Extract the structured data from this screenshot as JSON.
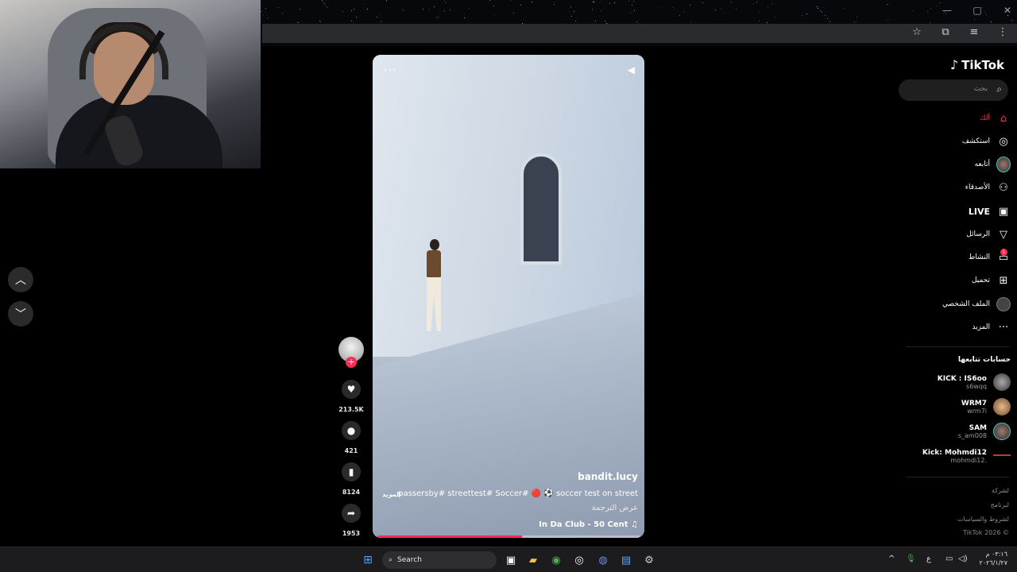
{
  "browser": {
    "window_controls": [
      "—",
      "▢",
      "✕"
    ],
    "toolbar_icons": [
      "star-icon",
      "extensions-icon",
      "media-icon",
      "menu-icon"
    ]
  },
  "nav_arrows": {
    "up": "︿",
    "down": "﹀"
  },
  "video": {
    "author": "bandit.lucy",
    "caption": "... passersby# streettest# Soccer# 🔴 ⚽ soccer test on street",
    "more": "المزيد",
    "translate": "عرض الترجمة",
    "music": "In Da Club - 50 Cent ♫",
    "progress_percent": 55
  },
  "actions": {
    "likes": "213.5K",
    "comments": "421",
    "saves": "8124",
    "shares": "1953"
  },
  "sidebar": {
    "logo": "TikTok",
    "search_placeholder": "بحث",
    "nav": [
      {
        "label": "ألك",
        "icon": "home-icon",
        "glyph": "⌂"
      },
      {
        "label": "استكشف",
        "icon": "compass-icon",
        "glyph": "◎"
      },
      {
        "label": "أتابعه",
        "icon": "following-avatar-icon",
        "glyph": ""
      },
      {
        "label": "الأصدقاء",
        "icon": "friends-icon",
        "glyph": "⚇"
      },
      {
        "label": "LIVE",
        "icon": "live-icon",
        "glyph": "▣"
      },
      {
        "label": "الرسائل",
        "icon": "messages-icon",
        "glyph": "▽"
      },
      {
        "label": "النشاط",
        "icon": "activity-icon",
        "glyph": "▭",
        "badge": "1"
      },
      {
        "label": "تحميل",
        "icon": "upload-icon",
        "glyph": "⊞"
      },
      {
        "label": "الملف الشخصي",
        "icon": "profile-icon",
        "glyph": ""
      },
      {
        "label": "المزيد",
        "icon": "more-icon",
        "glyph": "···"
      }
    ],
    "following_title": "حسابات تتابعها",
    "following": [
      {
        "name": "KICK : IS6oo",
        "handle": "s6wqq"
      },
      {
        "name": "WRM7",
        "handle": "wrm7i"
      },
      {
        "name": "SAM",
        "handle": "s_am008"
      },
      {
        "name": "Kick: Mohmdi12",
        "handle": "mohmdi12."
      }
    ],
    "footer": [
      "لشركة",
      "لبرنامج",
      "لشروط والسياسات",
      "TikTok 2026 ©"
    ]
  },
  "taskbar": {
    "search_label": "Search",
    "tray_lang": "ع",
    "time": "٠٣:١٦ م",
    "date": "٢٠٢٦/١/٢٧"
  }
}
